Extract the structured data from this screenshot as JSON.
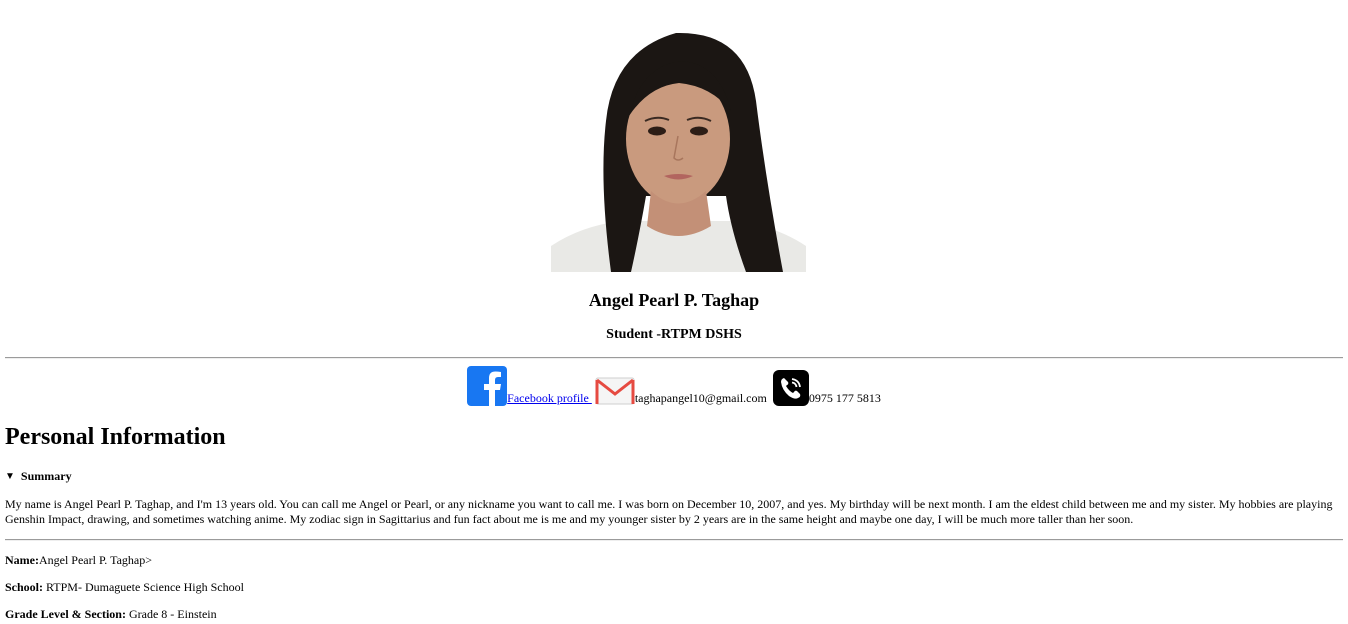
{
  "profile": {
    "name": "Angel Pearl P. Taghap",
    "role": "Student -RTPM DSHS"
  },
  "contacts": {
    "facebook_label": "Facebook profile ",
    "email": "taghapangel10@gmail.com",
    "phone": "0975 177 5813"
  },
  "section": {
    "title": "Personal Information"
  },
  "summary": {
    "label": "Summary",
    "text": "My name is Angel Pearl P. Taghap, and I'm 13 years old. You can call me Angel or Pearl, or any nickname you want to call me. I was born on December 10, 2007, and yes. My birthday will be next month. I am the eldest child between me and my sister. My hobbies are playing Genshin Impact, drawing, and sometimes watching anime. My zodiac sign in Sagittarius and fun fact about me is me and my younger sister by 2 years are in the same height and maybe one day, I will be much more taller than her soon."
  },
  "details": {
    "name_label": "Name:",
    "name_value": "Angel Pearl P. Taghap>",
    "school_label": "School:",
    "school_value": " RTPM- Dumaguete Science High School",
    "grade_label": "Grade Level & Section:",
    "grade_value": " Grade 8 - Einstein"
  },
  "icons": {
    "facebook": "facebook-icon",
    "email": "gmail-icon",
    "phone": "viber-phone-icon"
  },
  "colors": {
    "facebook_blue": "#1877f2",
    "link_blue": "#0000ee",
    "gmail_red": "#e64a41"
  }
}
